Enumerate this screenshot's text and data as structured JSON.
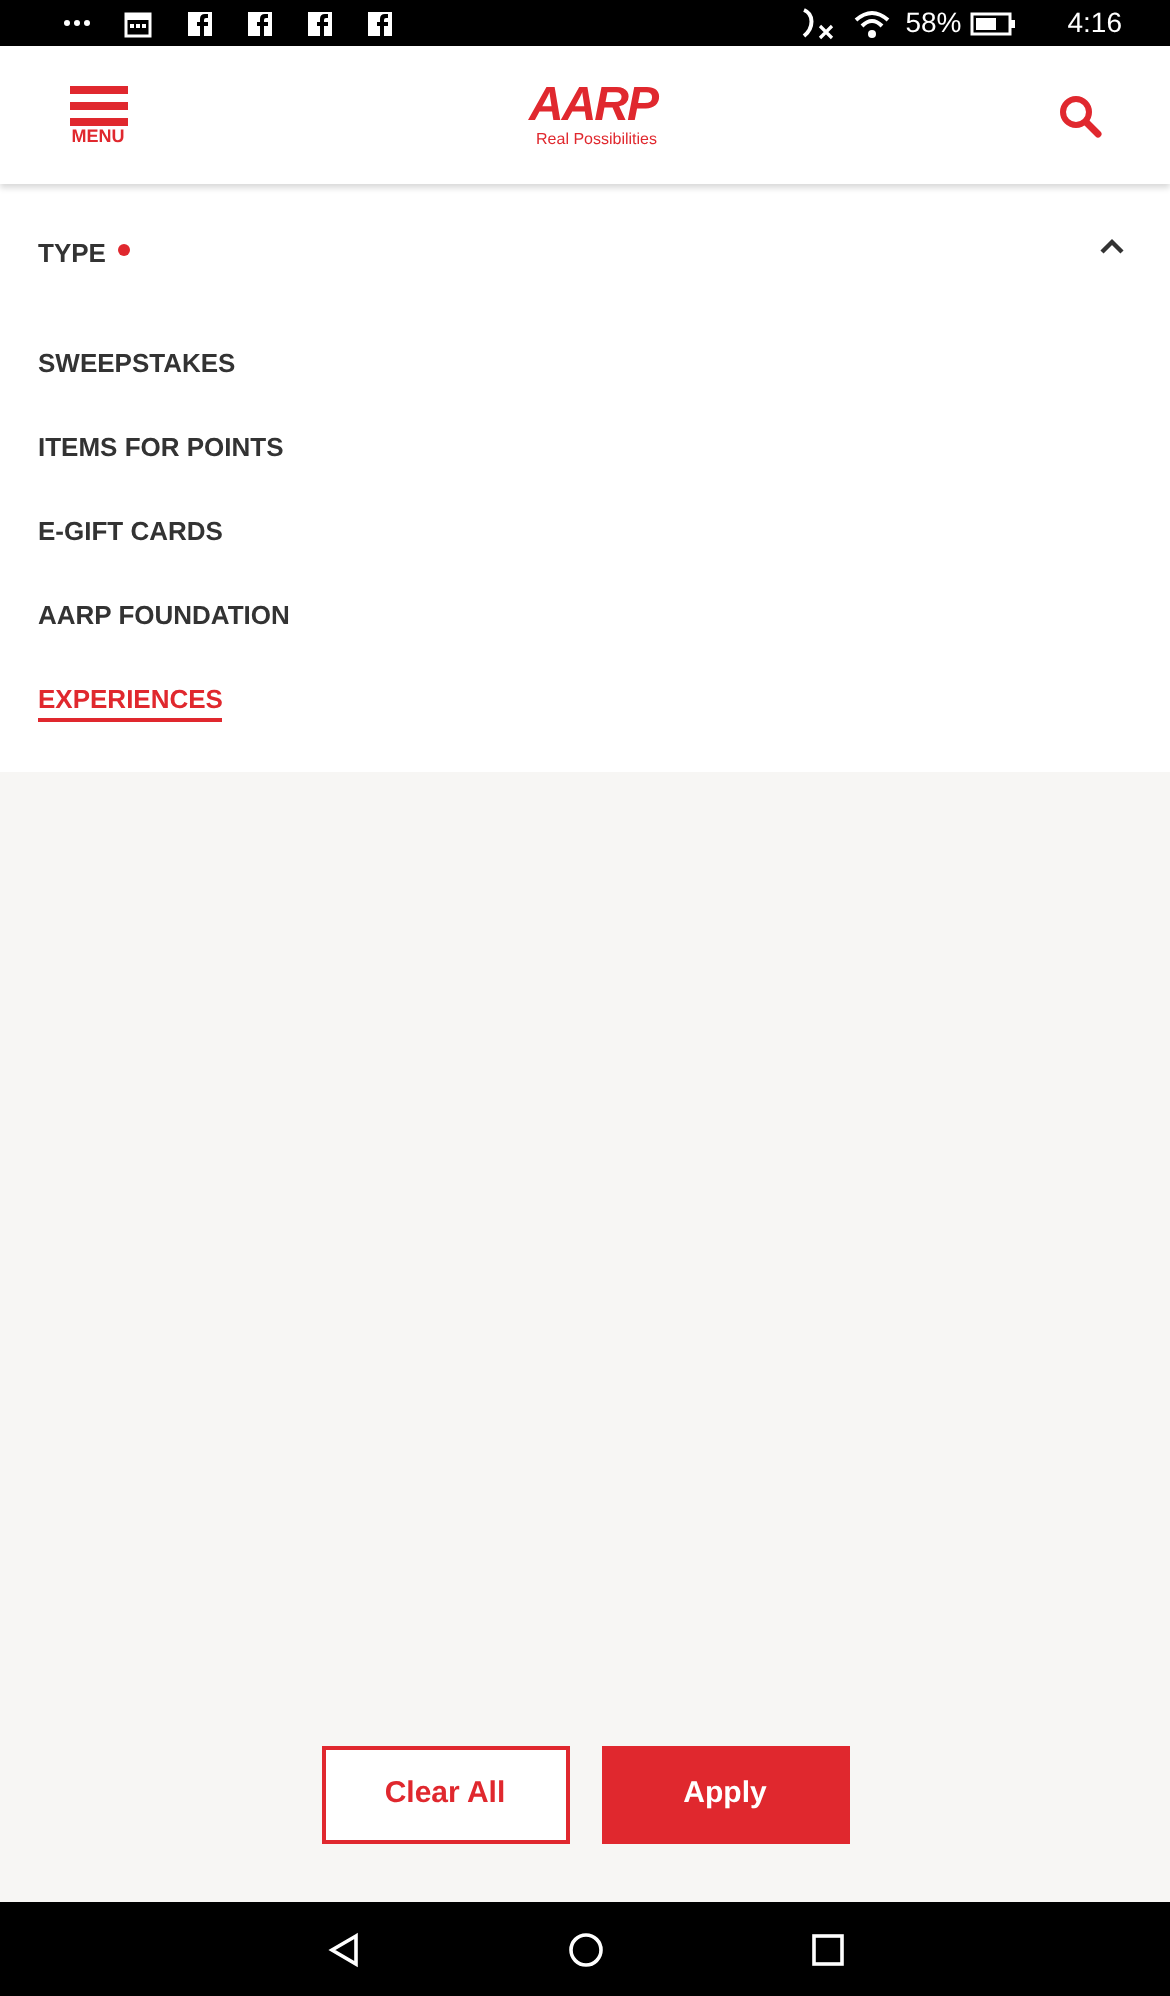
{
  "status_bar": {
    "battery": "58%",
    "time": "4:16"
  },
  "header": {
    "menu_label": "MENU",
    "logo": "AARP",
    "tagline": "Real Possibilities"
  },
  "filter": {
    "title": "TYPE",
    "active": true,
    "expanded": true,
    "options": [
      {
        "label": "SWEEPSTAKES",
        "selected": false
      },
      {
        "label": "ITEMS FOR POINTS",
        "selected": false
      },
      {
        "label": "E-GIFT CARDS",
        "selected": false
      },
      {
        "label": "AARP FOUNDATION",
        "selected": false
      },
      {
        "label": "EXPERIENCES",
        "selected": true
      }
    ]
  },
  "buttons": [
    {
      "label": "Clear All",
      "kind": "outline"
    },
    {
      "label": "Apply",
      "kind": "filled"
    }
  ]
}
